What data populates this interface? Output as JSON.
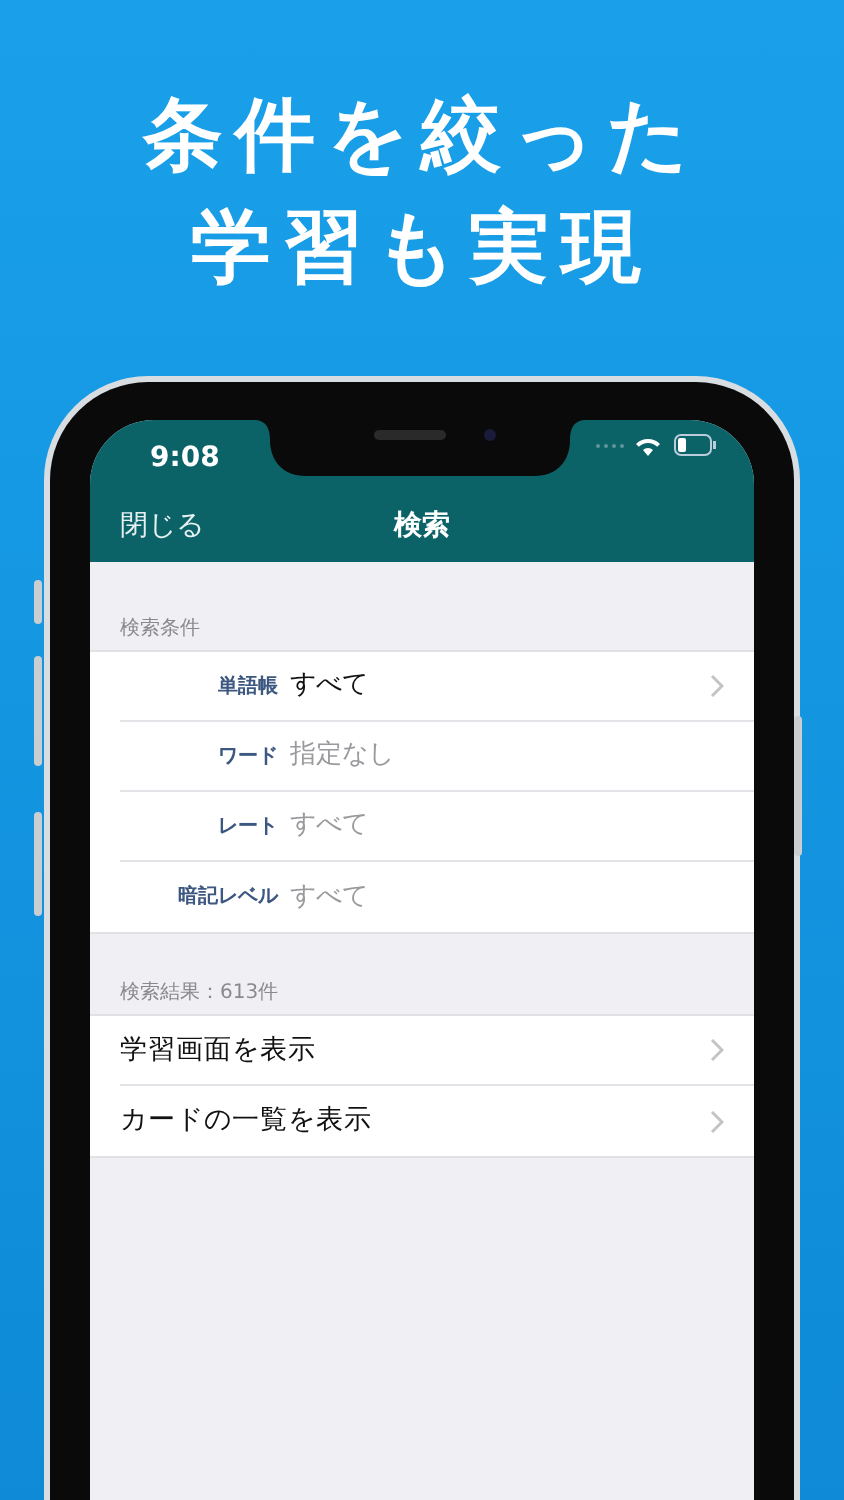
{
  "headline": [
    "条件を絞った",
    "学習も実現"
  ],
  "status_bar": {
    "time": "9:08"
  },
  "nav": {
    "left": "閉じる",
    "title": "検索"
  },
  "conditions": {
    "header": "検索条件",
    "rows": [
      {
        "label": "単語帳",
        "value": "すべて",
        "disabled": false
      },
      {
        "label": "ワード",
        "value": "指定なし",
        "disabled": true
      },
      {
        "label": "レート",
        "value": "すべて",
        "disabled": true
      },
      {
        "label": "暗記レベル",
        "value": "すべて",
        "disabled": true
      }
    ]
  },
  "results": {
    "header": "検索結果：613件",
    "rows": [
      {
        "label": "学習画面を表示"
      },
      {
        "label": "カードの一覧を表示"
      }
    ]
  }
}
